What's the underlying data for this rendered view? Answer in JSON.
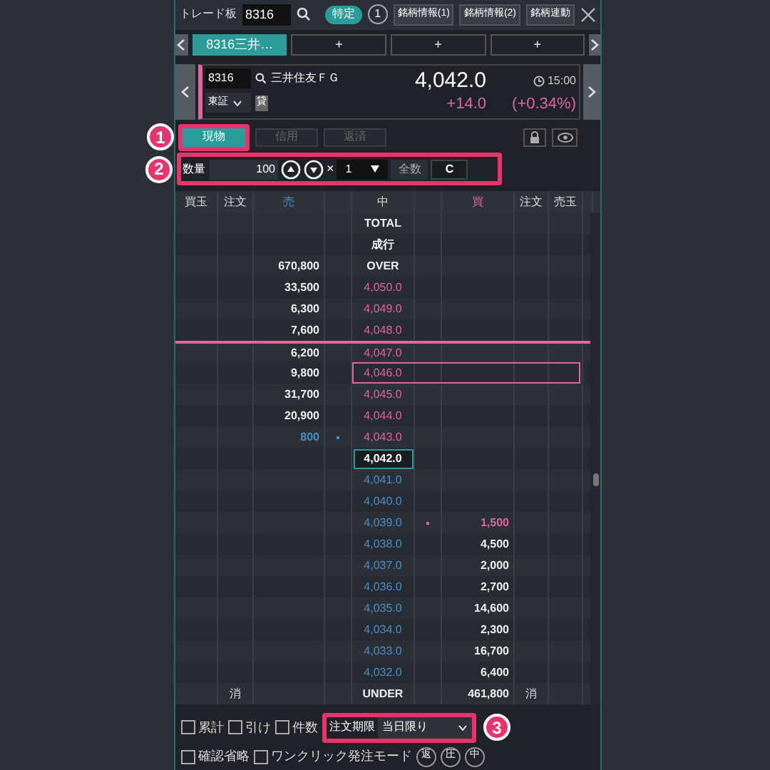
{
  "header": {
    "title": "トレード板",
    "code": "8316",
    "badge": "特定",
    "count": "1",
    "buttons": [
      "銘柄情報(1)",
      "銘柄情報(2)",
      "銘柄連動"
    ]
  },
  "tabs": [
    {
      "label": "8316三井…",
      "selected": true
    },
    {
      "label": "+",
      "selected": false
    },
    {
      "label": "+",
      "selected": false
    },
    {
      "label": "+",
      "selected": false
    }
  ],
  "quote": {
    "code": "8316",
    "name": "三井住友ＦＧ",
    "market": "東証",
    "tag": "貸",
    "price": "4,042.0",
    "time": "15:00",
    "change": "+14.0",
    "change_pct": "(+0.34%)"
  },
  "order_types": [
    {
      "label": "現物",
      "selected": true,
      "callout": "1"
    },
    {
      "label": "信用",
      "selected": false
    },
    {
      "label": "返済",
      "selected": false
    }
  ],
  "quantity": {
    "callout": "2",
    "label": "数量",
    "value": "100",
    "times": "×",
    "multiplier": "1",
    "buttons": [
      "全数",
      "C"
    ]
  },
  "columns": [
    {
      "label": "買玉",
      "kind": "plain"
    },
    {
      "label": "注文",
      "kind": "plain"
    },
    {
      "label": "売",
      "kind": "sell"
    },
    {
      "label": "中",
      "kind": "plain"
    },
    {
      "label": "買",
      "kind": "buy"
    },
    {
      "label": "注文",
      "kind": "plain"
    },
    {
      "label": "売玉",
      "kind": "plain"
    }
  ],
  "rows": [
    {
      "price": "TOTAL",
      "kind": "label",
      "selected": false
    },
    {
      "price": "成行",
      "kind": "label",
      "selected": false
    },
    {
      "price": "OVER",
      "kind": "label",
      "sell": "670,800",
      "selected": false
    },
    {
      "price": "4,050.0",
      "kind": "sell",
      "sell": "33,500",
      "selected": false
    },
    {
      "price": "4,049.0",
      "kind": "sell",
      "sell": "6,300",
      "selected": false
    },
    {
      "price": "4,048.0",
      "kind": "sell",
      "sell": "7,600",
      "selected": false
    },
    {
      "price": "4,047.0",
      "kind": "sell",
      "sell": "6,200",
      "selected": false
    },
    {
      "price": "4,046.0",
      "kind": "sell",
      "sell": "9,800",
      "selected": true
    },
    {
      "price": "4,045.0",
      "kind": "sell",
      "sell": "31,700",
      "selected": false
    },
    {
      "price": "4,044.0",
      "kind": "sell",
      "sell": "20,900",
      "selected": false
    },
    {
      "price": "4,043.0",
      "kind": "sell",
      "sell": "800",
      "sell_dot": true,
      "selected": false
    },
    {
      "price": "4,042.0",
      "kind": "current",
      "selected": false
    },
    {
      "price": "4,041.0",
      "kind": "buy",
      "selected": false
    },
    {
      "price": "4,040.0",
      "kind": "buy",
      "selected": false
    },
    {
      "price": "4,039.0",
      "kind": "buy",
      "buy": "1,500",
      "buy_dot": true,
      "selected": false
    },
    {
      "price": "4,038.0",
      "kind": "buy",
      "buy": "4,500",
      "selected": false
    },
    {
      "price": "4,037.0",
      "kind": "buy",
      "buy": "2,000",
      "selected": false
    },
    {
      "price": "4,036.0",
      "kind": "buy",
      "buy": "2,700",
      "selected": false
    },
    {
      "price": "4,035.0",
      "kind": "buy",
      "buy": "14,600",
      "selected": false
    },
    {
      "price": "4,034.0",
      "kind": "buy",
      "buy": "2,300",
      "selected": false
    },
    {
      "price": "4,033.0",
      "kind": "buy",
      "buy": "16,700",
      "selected": false
    },
    {
      "price": "4,032.0",
      "kind": "buy",
      "buy": "6,400",
      "selected": false
    },
    {
      "price": "UNDER",
      "kind": "label",
      "buy": "461,800",
      "sell_order": "消",
      "buy_order": "消",
      "selected": false
    }
  ],
  "options": [
    {
      "label": "累計",
      "checked": false
    },
    {
      "label": "引け",
      "checked": false
    },
    {
      "label": "件数",
      "checked": false
    }
  ],
  "expiry": {
    "callout": "3",
    "label": "注文期限",
    "value": "当日限り"
  },
  "options2": [
    {
      "label": "確認省略",
      "checked": false
    },
    {
      "label": "ワンクリック発注モード",
      "checked": false
    }
  ],
  "round_buttons": [
    "返",
    "圧",
    "中"
  ]
}
